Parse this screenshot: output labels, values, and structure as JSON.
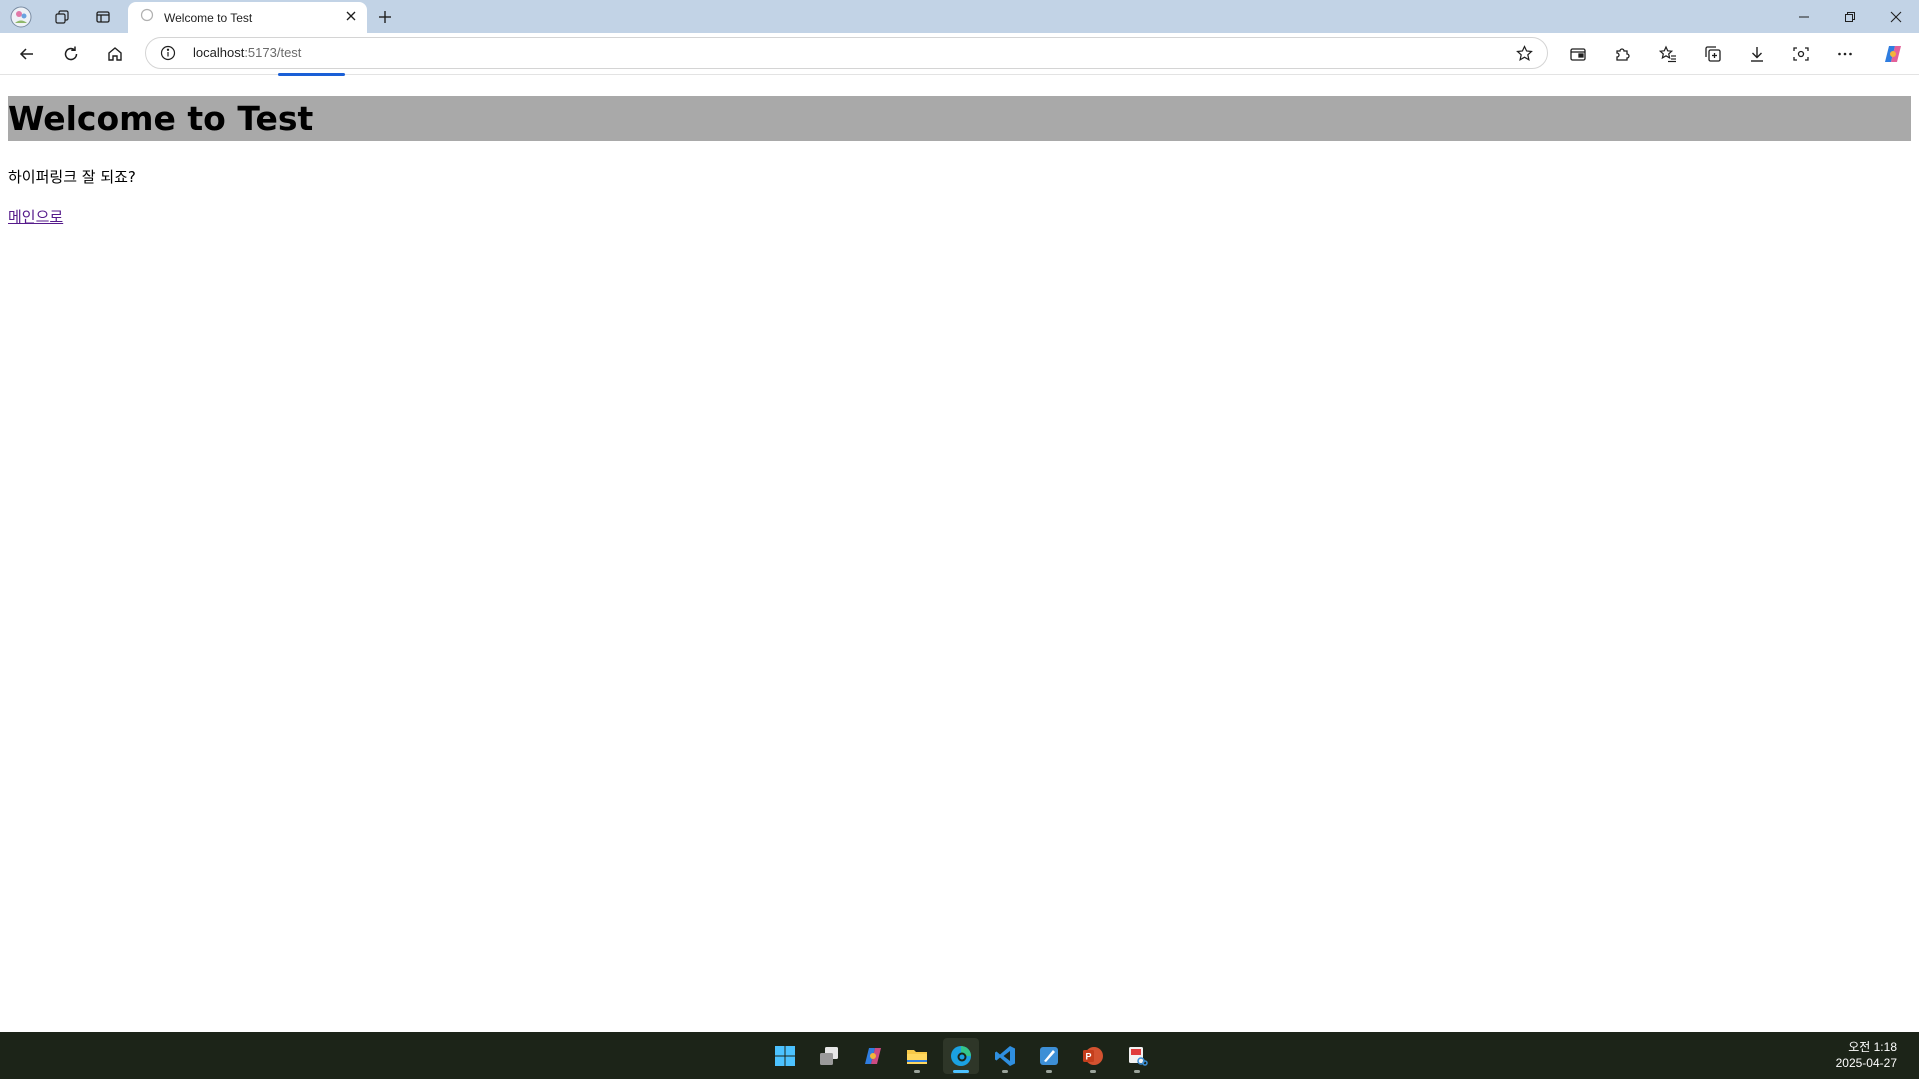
{
  "browser": {
    "tab_title": "Welcome to Test",
    "address_host": "localhost",
    "address_rest": ":5173/test",
    "colors": {
      "tabstrip": "#c2d3e6",
      "progress": "#1a5fd6"
    }
  },
  "icons": {
    "profile": "profile-avatar-icon",
    "workspaces": "workspaces-icon",
    "vertical_tabs": "vertical-tabs-icon",
    "new_tab": "plus-icon",
    "back": "back-arrow-icon",
    "refresh": "refresh-icon",
    "home": "home-icon",
    "site_info": "info-icon",
    "favorite": "star-icon",
    "toolbar_right": [
      "wallet-icon",
      "extensions-icon",
      "favorites-icon",
      "collections-icon",
      "download-icon",
      "screenshot-icon",
      "more-icon",
      "copilot-icon"
    ]
  },
  "page": {
    "heading": "Welcome to Test",
    "paragraph": "하이퍼링크 잘 되죠?",
    "link": "메인으로",
    "colors": {
      "heading_bg": "#a9a9a9",
      "link": "#551a8b"
    }
  },
  "taskbar": {
    "apps": [
      "start-icon",
      "task-view-icon",
      "copilot-icon",
      "file-explorer-icon",
      "edge-icon",
      "vscode-icon",
      "paint-icon",
      "powerpoint-icon",
      "snipping-tool-icon"
    ],
    "time": "오전 1:18",
    "date": "2025-04-27"
  }
}
